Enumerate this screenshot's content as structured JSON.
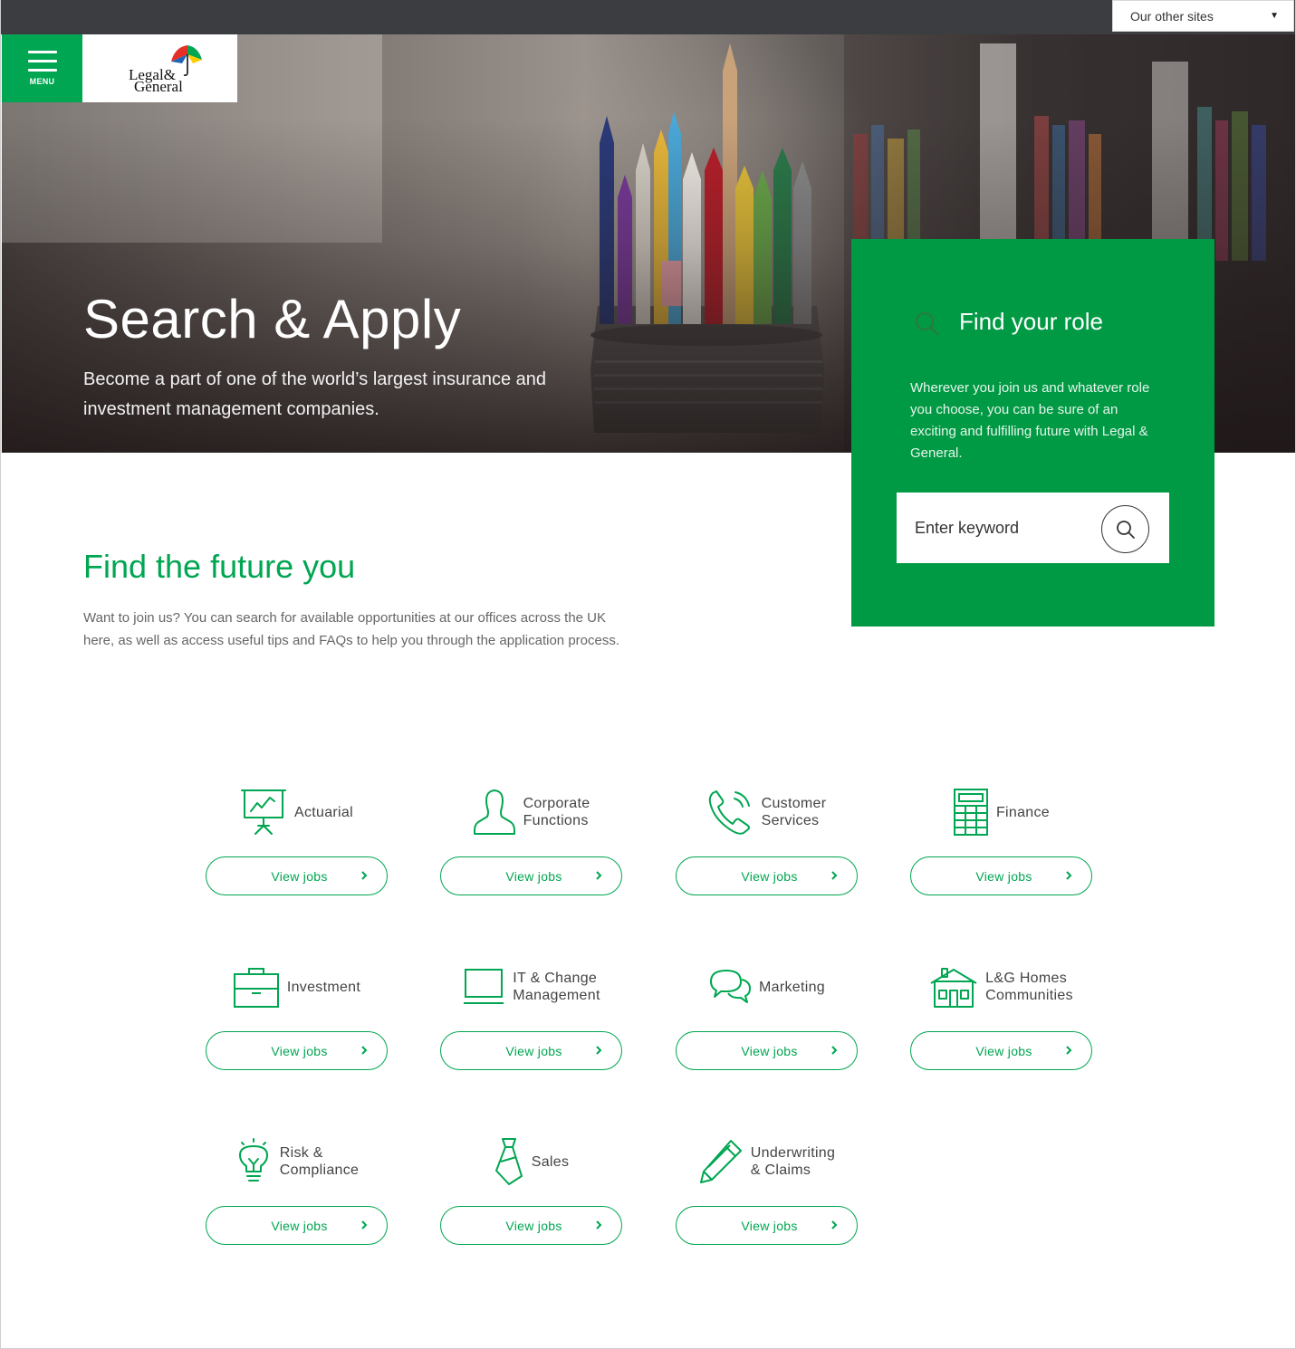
{
  "topbar": {
    "other_sites_label": "Our other sites"
  },
  "header": {
    "menu_label": "MENU",
    "logo_line1": "Legal&",
    "logo_line2": "General"
  },
  "hero": {
    "title": "Search & Apply",
    "subtitle": "Become a part of one of the world’s largest insurance and investment management companies."
  },
  "find_role": {
    "title": "Find your role",
    "description": "Wherever you join us and whatever role you choose, you can be sure of an exciting and fulfilling future with Legal & General.",
    "search_placeholder": "Enter keyword"
  },
  "intro": {
    "title": "Find the future you",
    "text": "Want to join us? You can search for available opportunities at our offices across the UK here, as well as access useful tips and FAQs to help you through the application process."
  },
  "colors": {
    "brand_green": "#00a651",
    "panel_green": "#009a44",
    "topbar": "#3c3d40"
  },
  "categories": [
    {
      "line1": "Actuarial",
      "line2": "",
      "icon": "presentation-chart-icon",
      "button": "View jobs"
    },
    {
      "line1": "Corporate",
      "line2": "Functions",
      "icon": "person-icon",
      "button": "View jobs"
    },
    {
      "line1": "Customer",
      "line2": "Services",
      "icon": "phone-icon",
      "button": "View jobs"
    },
    {
      "line1": "Finance",
      "line2": "",
      "icon": "calculator-icon",
      "button": "View jobs"
    },
    {
      "line1": "Investment",
      "line2": "",
      "icon": "briefcase-icon",
      "button": "View jobs"
    },
    {
      "line1": "IT & Change",
      "line2": "Management",
      "icon": "laptop-icon",
      "button": "View jobs"
    },
    {
      "line1": "Marketing",
      "line2": "",
      "icon": "speech-bubbles-icon",
      "button": "View jobs"
    },
    {
      "line1": "L&G Homes",
      "line2": "Communities",
      "icon": "house-icon",
      "button": "View jobs"
    },
    {
      "line1": "Risk &",
      "line2": "Compliance",
      "icon": "lightbulb-icon",
      "button": "View jobs"
    },
    {
      "line1": "Sales",
      "line2": "",
      "icon": "tie-icon",
      "button": "View jobs"
    },
    {
      "line1": "Underwriting",
      "line2": "& Claims",
      "icon": "pencil-icon",
      "button": "View jobs"
    }
  ]
}
